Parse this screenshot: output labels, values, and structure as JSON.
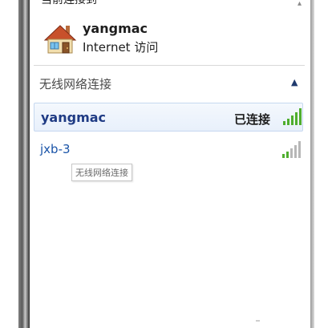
{
  "current_connection": {
    "header_label": "当前连接到",
    "network_name": "yangmac",
    "access_status": "Internet 访问",
    "icon": "house-icon"
  },
  "wireless_section": {
    "title": "无线网络连接",
    "toggle_icon": "chevron-up-icon",
    "networks": [
      {
        "name": "yangmac",
        "status": "已连接",
        "selected": true,
        "signal_bars_filled": 5,
        "icon": "signal-strength-icon"
      },
      {
        "name": "jxb-3",
        "status": "",
        "selected": false,
        "signal_bars_filled": 2,
        "icon": "signal-strength-icon"
      }
    ]
  },
  "tooltip": {
    "text": "无线网络连接"
  },
  "colors": {
    "selected_bg": "#e8f0fb",
    "selected_border": "#c6d8f0",
    "link_blue": "#1a54a8",
    "signal_green": "#4fae2e",
    "signal_gray": "#b7b7b7"
  }
}
